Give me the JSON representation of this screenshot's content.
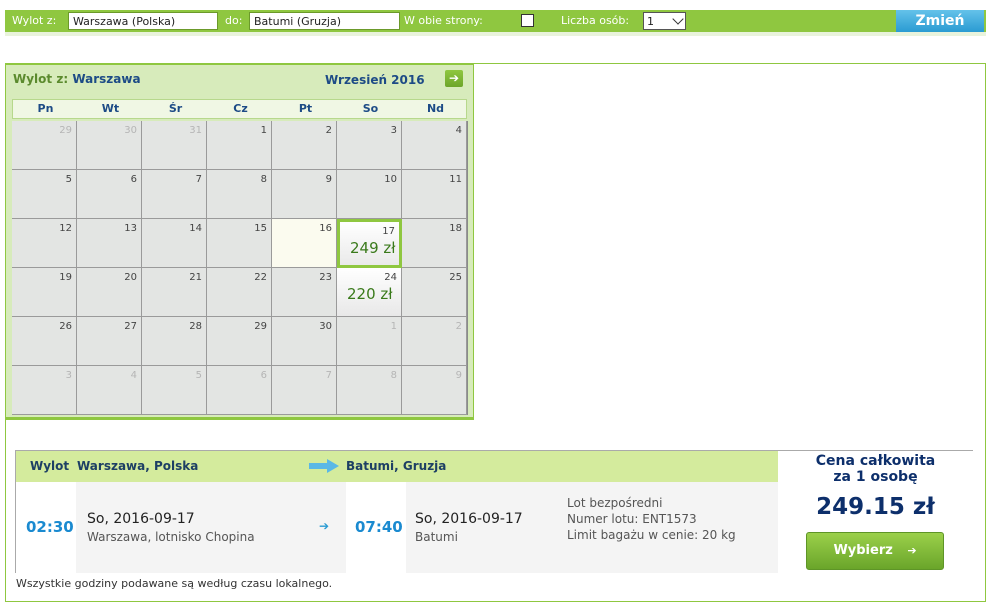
{
  "search": {
    "from_label": "Wylot z:",
    "from_value": "Warszawa (Polska)",
    "to_label": "do:",
    "to_value": "Batumi (Gruzja)",
    "roundtrip_label": "W obie strony:",
    "roundtrip_checked": false,
    "persons_label": "Liczba osób:",
    "persons_value": "1",
    "change_button": "Zmień"
  },
  "calendar": {
    "header_prefix": "Wylot z:",
    "header_city": "Warszawa",
    "month": "Wrzesień 2016",
    "next_icon": "arrow-right-icon",
    "weekdays": [
      "Pn",
      "Wt",
      "Śr",
      "Cz",
      "Pt",
      "So",
      "Nd"
    ],
    "days": [
      {
        "d": "29",
        "other": true
      },
      {
        "d": "30",
        "other": true
      },
      {
        "d": "31",
        "other": true
      },
      {
        "d": "1"
      },
      {
        "d": "2"
      },
      {
        "d": "3"
      },
      {
        "d": "4"
      },
      {
        "d": "5"
      },
      {
        "d": "6"
      },
      {
        "d": "7"
      },
      {
        "d": "8"
      },
      {
        "d": "9"
      },
      {
        "d": "10"
      },
      {
        "d": "11"
      },
      {
        "d": "12"
      },
      {
        "d": "13"
      },
      {
        "d": "14"
      },
      {
        "d": "15"
      },
      {
        "d": "16",
        "hl": true
      },
      {
        "d": "17",
        "price": "249 zł",
        "selected": true
      },
      {
        "d": "18"
      },
      {
        "d": "19"
      },
      {
        "d": "20"
      },
      {
        "d": "21"
      },
      {
        "d": "22"
      },
      {
        "d": "23"
      },
      {
        "d": "24",
        "price": "220 zł"
      },
      {
        "d": "25"
      },
      {
        "d": "26"
      },
      {
        "d": "27"
      },
      {
        "d": "28"
      },
      {
        "d": "29"
      },
      {
        "d": "30"
      },
      {
        "d": "1",
        "other": true
      },
      {
        "d": "2",
        "other": true
      },
      {
        "d": "3",
        "other": true
      },
      {
        "d": "4",
        "other": true
      },
      {
        "d": "5",
        "other": true
      },
      {
        "d": "6",
        "other": true
      },
      {
        "d": "7",
        "other": true
      },
      {
        "d": "8",
        "other": true
      },
      {
        "d": "9",
        "other": true
      }
    ]
  },
  "flight": {
    "direction_label": "Wylot",
    "from_city": "Warszawa, Polska",
    "to_city": "Batumi, Gruzja",
    "dep_time": "02:30",
    "dep_date": "So, 2016-09-17",
    "dep_place": "Warszawa, lotnisko Chopina",
    "arr_time": "07:40",
    "arr_date": "So, 2016-09-17",
    "arr_place": "Batumi",
    "info_direct": "Lot bezpośredni",
    "info_flight_no": "Numer lotu: ENT1573",
    "info_baggage": "Limit bagażu w cenie: 20 kg",
    "price_title_1": "Cena całkowita",
    "price_title_2": "za 1 osobę",
    "price": "249.15 zł",
    "select_button": "Wybierz",
    "select_icon": "arrow-right-icon"
  },
  "note": "Wszystkie godziny podawane są według czasu lokalnego.",
  "colors": {
    "accent_green": "#8fc740",
    "accent_blue": "#2a9bd2",
    "navy": "#0d2f6b"
  }
}
